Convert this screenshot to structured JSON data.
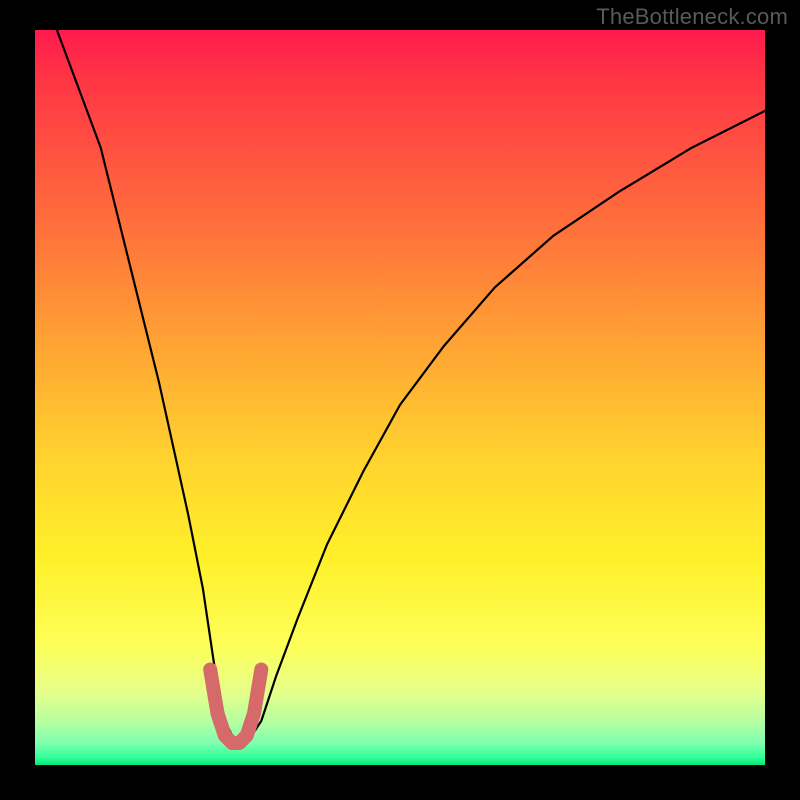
{
  "watermark": "TheBottleneck.com",
  "colors": {
    "page_bg": "#000000",
    "curve": "#000000",
    "marker": "#d66a6a",
    "gradient_top": "#ff1a4d",
    "gradient_bottom": "#00e878"
  },
  "chart_data": {
    "type": "line",
    "title": "",
    "xlabel": "",
    "ylabel": "",
    "xlim": [
      0,
      100
    ],
    "ylim": [
      0,
      100
    ],
    "x_note": "horizontal position across plot (0=left, 100=right)",
    "y_note": "vertical position (0=bottom/green, 100=top/red); curve shows bottleneck severity, minimum is optimal",
    "grid": false,
    "legend": false,
    "series": [
      {
        "name": "bottleneck-curve",
        "x": [
          0,
          3,
          6,
          9,
          11,
          13,
          15,
          17,
          19,
          21,
          23,
          24.5,
          26,
          27.5,
          29,
          31,
          33,
          36,
          40,
          45,
          50,
          56,
          63,
          71,
          80,
          90,
          100
        ],
        "values": [
          108,
          100,
          92,
          84,
          76,
          68,
          60,
          52,
          43,
          34,
          24,
          14,
          6,
          3,
          3,
          6,
          12,
          20,
          30,
          40,
          49,
          57,
          65,
          72,
          78,
          84,
          89
        ]
      }
    ],
    "marker_segment": {
      "description": "thick salmon-colored U at the curve minimum",
      "x": [
        24,
        25,
        26,
        27,
        28,
        29,
        30,
        31
      ],
      "values": [
        13,
        7,
        4,
        3,
        3,
        4,
        7,
        13
      ]
    }
  }
}
